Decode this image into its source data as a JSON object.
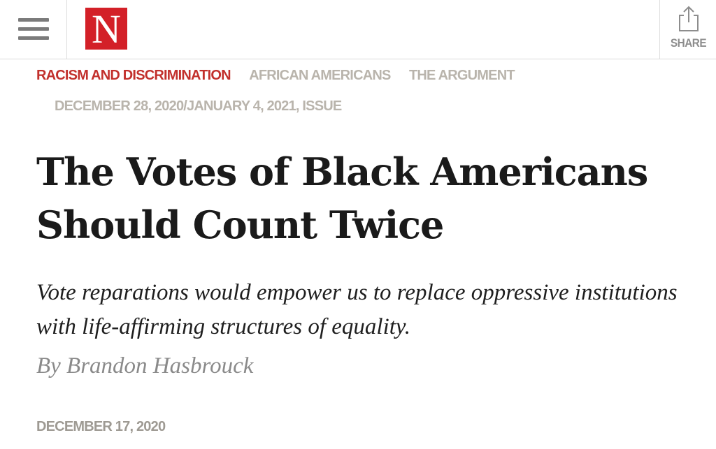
{
  "header": {
    "logo_letter": "N",
    "share_label": "SHARE",
    "menu_icon": "hamburger-icon",
    "share_icon": "share-icon",
    "brand_color": "#d32028"
  },
  "tags": [
    {
      "label": "RACISM AND DISCRIMINATION"
    },
    {
      "label": "AFRICAN AMERICANS"
    },
    {
      "label": "THE ARGUMENT"
    }
  ],
  "issue": "DECEMBER 28, 2020/JANUARY 4, 2021, ISSUE",
  "article": {
    "headline_line1": "The Votes of Black Americans",
    "headline_line2": "Should Count Twice",
    "dek": "Vote reparations would empower us to replace oppressive institutions with life-affirming structures of equality.",
    "byline": "By Brandon Hasbrouck",
    "date": "DECEMBER 17, 2020"
  },
  "colors": {
    "primary_tag": "#c2302c",
    "secondary_tag": "#b9b4ac"
  }
}
